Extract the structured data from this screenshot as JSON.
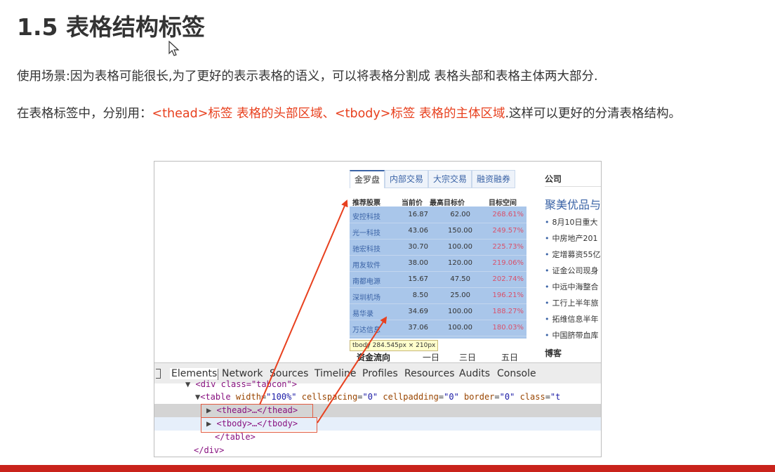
{
  "slide": {
    "title": "1.5 表格结构标签",
    "p1": "使用场景:因为表格可能很长,为了更好的表示表格的语义，可以将表格分割成 表格头部和表格主体两大部分.",
    "p2_a": "在表格标签中，分别用：",
    "p2_red": "<thead>标签 表格的头部区域、<tbody>标签 表格的主体区域",
    "p2_b": ".这样可以更好的分清表格结构。"
  },
  "tabs": [
    "金罗盘",
    "内部交易",
    "大宗交易",
    "融资融券"
  ],
  "stock_table": {
    "headers": [
      "推荐股票",
      "当前价",
      "最高目标价",
      "目标空间"
    ],
    "rows": [
      [
        "安控科技",
        "16.87",
        "62.00",
        "268.61%"
      ],
      [
        "光一科技",
        "43.06",
        "150.00",
        "249.57%"
      ],
      [
        "驰宏科技",
        "30.70",
        "100.00",
        "225.73%"
      ],
      [
        "用友软件",
        "38.00",
        "120.00",
        "219.06%"
      ],
      [
        "南都电源",
        "15.67",
        "47.50",
        "202.74%"
      ],
      [
        "深圳机场",
        "8.50",
        "25.00",
        "196.21%"
      ],
      [
        "易华录",
        "34.69",
        "100.00",
        "188.27%"
      ],
      [
        "万达信息",
        "37.06",
        "100.00",
        "180.03%"
      ]
    ]
  },
  "tooltip": "tbody 284.545px × 210px",
  "subtabs": [
    "资金流向",
    "一日",
    "三日",
    "五日"
  ],
  "side": {
    "title": "公司",
    "headline": "聚美优品与",
    "items": [
      "8月10日重大",
      "中房地产201",
      "定增募资55亿",
      "证金公司现身",
      "中远中海整合",
      "工行上半年旅",
      "拓维信息半年",
      "中国脐带血库"
    ],
    "title2": "博客"
  },
  "devtools": {
    "tabs": [
      "Elements",
      "Network",
      "Sources",
      "Timeline",
      "Profiles",
      "Resources",
      "Audits",
      "Console"
    ]
  },
  "code": {
    "l0_tag": "<div class=\"tabcon\">",
    "l1_a": "<table ",
    "l1_w_attr": "width",
    "l1_w_val": "\"100%\"",
    "l1_cs_attr": "cellspacing",
    "l1_cs_val": "\"0\"",
    "l1_cp_attr": "cellpadding",
    "l1_cp_val": "\"0\"",
    "l1_b_attr": "border",
    "l1_b_val": "\"0\"",
    "l1_c_attr": "class",
    "l1_c_val": "\"t",
    "thead": "<thead>…</thead>",
    "tbody": "<tbody>…</tbody>",
    "end_table": "</table>",
    "end_div": "</div>"
  },
  "colors": {
    "accent_red": "#e8401e",
    "bottom_bar": "#c9231b",
    "table_highlight": "#a9c6ea"
  },
  "icons": {
    "cursor": "mouse-cursor-icon",
    "devtools_toggle": "devtools-dock-icon"
  }
}
